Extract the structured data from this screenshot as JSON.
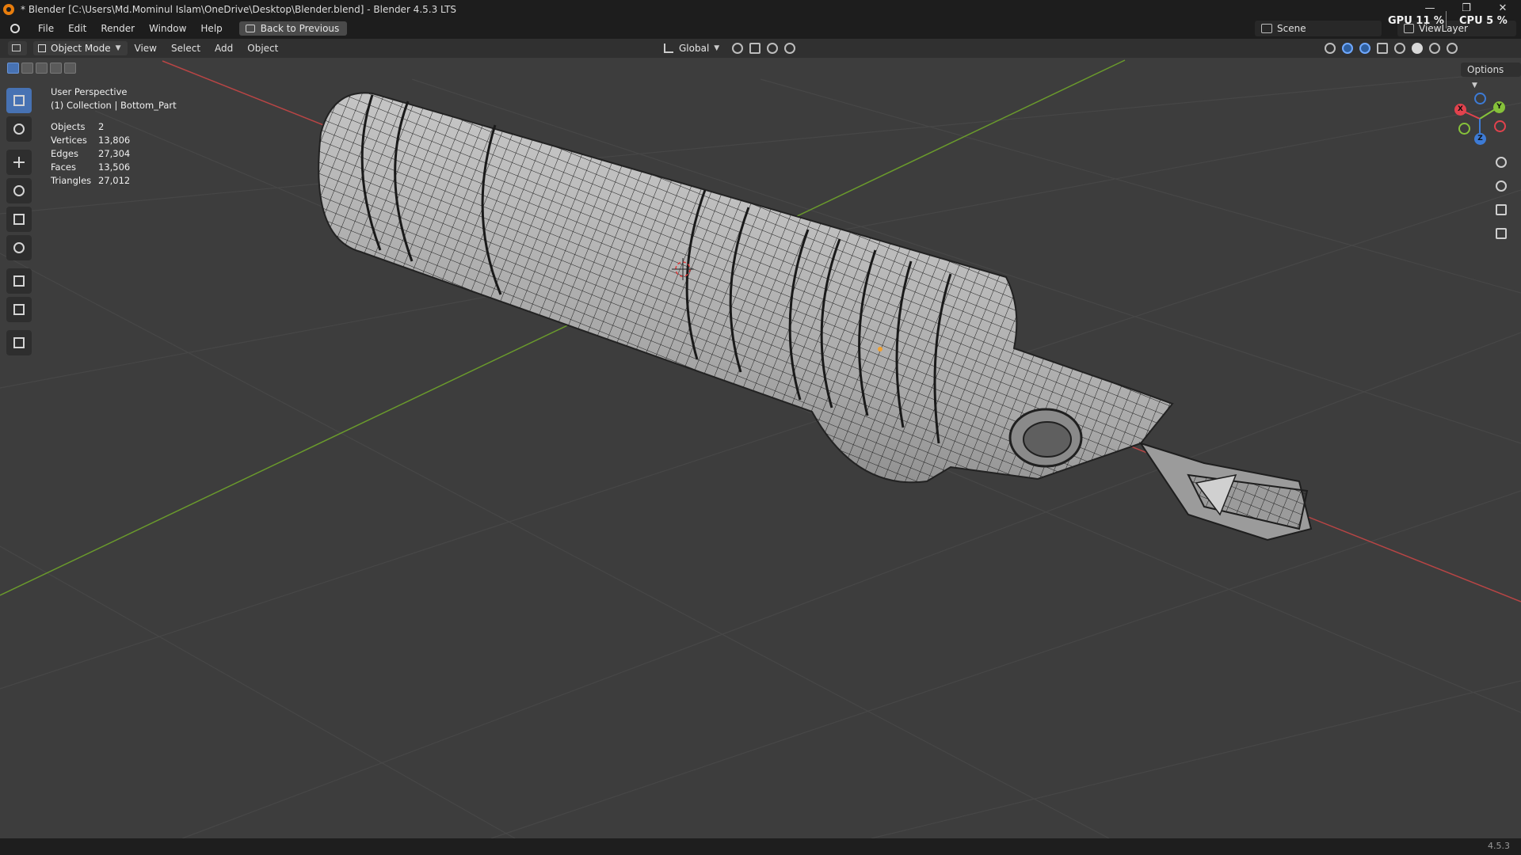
{
  "window": {
    "title": "* Blender [C:\\Users\\Md.Mominul Islam\\OneDrive\\Desktop\\Blender.blend] - Blender 4.5.3 LTS",
    "controls": [
      "—",
      "❐",
      "✕"
    ]
  },
  "menubar": {
    "items": [
      "File",
      "Edit",
      "Render",
      "Window",
      "Help"
    ],
    "back_button": "Back to Previous",
    "scene": "Scene",
    "view_layer": "ViewLayer",
    "gpu": "GPU 11 %",
    "cpu": "CPU 5 %"
  },
  "viewport_header": {
    "mode": "Object Mode",
    "menus": [
      "View",
      "Select",
      "Add",
      "Object"
    ],
    "orientation": "Global",
    "options_label": "Options"
  },
  "overlay": {
    "perspective": "User Perspective",
    "collection": "(1) Collection | Bottom_Part",
    "stats": [
      {
        "label": "Objects",
        "value": "2"
      },
      {
        "label": "Vertices",
        "value": "13,806"
      },
      {
        "label": "Edges",
        "value": "27,304"
      },
      {
        "label": "Faces",
        "value": "13,506"
      },
      {
        "label": "Triangles",
        "value": "27,012"
      }
    ]
  },
  "gizmo": {
    "x": "X",
    "y": "Y",
    "z": "Z",
    "x_color": "#e2424d",
    "y_color": "#86c23a",
    "z_color": "#3d7bd6"
  },
  "toolbar": {
    "tools": [
      "select-box",
      "cursor",
      "move",
      "rotate",
      "scale",
      "transform",
      "annotate",
      "measure",
      "add-cube"
    ]
  },
  "status": {
    "version": "4.5.3"
  },
  "colors": {
    "accent": "#4772b3",
    "x_axis": "#b84545",
    "y_axis": "#6a9a2c",
    "background": "#3d3d3d"
  }
}
